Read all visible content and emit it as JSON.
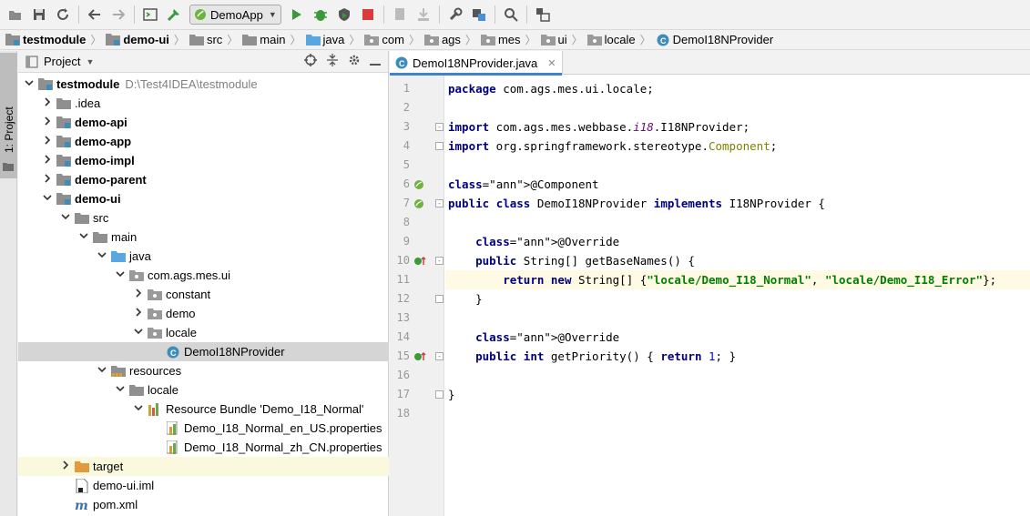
{
  "toolbar": {
    "run_config": "DemoApp",
    "icons": [
      "open-icon",
      "save-icon",
      "sync-icon",
      "back-icon",
      "forward-icon",
      "terminal-icon",
      "build-icon",
      "run-icon",
      "debug-icon",
      "coverage-icon",
      "stop-icon",
      "vcs-update-icon",
      "vcs-commit-icon",
      "settings-icon",
      "project-structure-icon",
      "search-icon",
      "sdk-icon"
    ]
  },
  "breadcrumb": [
    "testmodule",
    "demo-ui",
    "src",
    "main",
    "java",
    "com",
    "ags",
    "mes",
    "ui",
    "locale",
    "DemoI18NProvider"
  ],
  "strip": {
    "label": "1: Project"
  },
  "project": {
    "title": "Project",
    "tree": [
      {
        "depth": 0,
        "arrow": "v",
        "icon": "module",
        "label": "testmodule",
        "bold": true,
        "path": "D:\\Test4IDEA\\testmodule"
      },
      {
        "depth": 1,
        "arrow": ">",
        "icon": "folder",
        "label": ".idea"
      },
      {
        "depth": 1,
        "arrow": ">",
        "icon": "module",
        "label": "demo-api",
        "bold": true
      },
      {
        "depth": 1,
        "arrow": ">",
        "icon": "module",
        "label": "demo-app",
        "bold": true
      },
      {
        "depth": 1,
        "arrow": ">",
        "icon": "module",
        "label": "demo-impl",
        "bold": true
      },
      {
        "depth": 1,
        "arrow": ">",
        "icon": "module",
        "label": "demo-parent",
        "bold": true
      },
      {
        "depth": 1,
        "arrow": "v",
        "icon": "module",
        "label": "demo-ui",
        "bold": true
      },
      {
        "depth": 2,
        "arrow": "v",
        "icon": "folder",
        "label": "src"
      },
      {
        "depth": 3,
        "arrow": "v",
        "icon": "folder",
        "label": "main"
      },
      {
        "depth": 4,
        "arrow": "v",
        "icon": "src-folder",
        "label": "java"
      },
      {
        "depth": 5,
        "arrow": "v",
        "icon": "package",
        "label": "com.ags.mes.ui"
      },
      {
        "depth": 6,
        "arrow": ">",
        "icon": "package",
        "label": "constant"
      },
      {
        "depth": 6,
        "arrow": ">",
        "icon": "package",
        "label": "demo"
      },
      {
        "depth": 6,
        "arrow": "v",
        "icon": "package",
        "label": "locale"
      },
      {
        "depth": 7,
        "arrow": "",
        "icon": "class",
        "label": "DemoI18NProvider",
        "selected": true
      },
      {
        "depth": 4,
        "arrow": "v",
        "icon": "res-folder",
        "label": "resources"
      },
      {
        "depth": 5,
        "arrow": "v",
        "icon": "folder",
        "label": "locale"
      },
      {
        "depth": 6,
        "arrow": "v",
        "icon": "bundle",
        "label": "Resource Bundle 'Demo_I18_Normal'"
      },
      {
        "depth": 7,
        "arrow": "",
        "icon": "props",
        "label": "Demo_I18_Normal_en_US.properties"
      },
      {
        "depth": 7,
        "arrow": "",
        "icon": "props",
        "label": "Demo_I18_Normal_zh_CN.properties"
      },
      {
        "depth": 2,
        "arrow": ">",
        "icon": "target-folder",
        "label": "target",
        "highlight": true
      },
      {
        "depth": 2,
        "arrow": "",
        "icon": "iml",
        "label": "demo-ui.iml"
      },
      {
        "depth": 2,
        "arrow": "",
        "icon": "maven",
        "label": "pom.xml"
      }
    ]
  },
  "editor": {
    "tab": "DemoI18NProvider.java",
    "current_line": 11,
    "lines": [
      "package com.ags.mes.ui.locale;",
      "",
      "import com.ags.mes.webbase.i18.I18NProvider;",
      "import org.springframework.stereotype.Component;",
      "",
      "@Component",
      "public class DemoI18NProvider implements I18NProvider {",
      "",
      "    @Override",
      "    public String[] getBaseNames() {",
      "        return new String[] {\"locale/Demo_I18_Normal\", \"locale/Demo_I18_Error\"};",
      "    }",
      "",
      "    @Override",
      "    public int getPriority() { return 1; }",
      "",
      "}",
      ""
    ]
  }
}
